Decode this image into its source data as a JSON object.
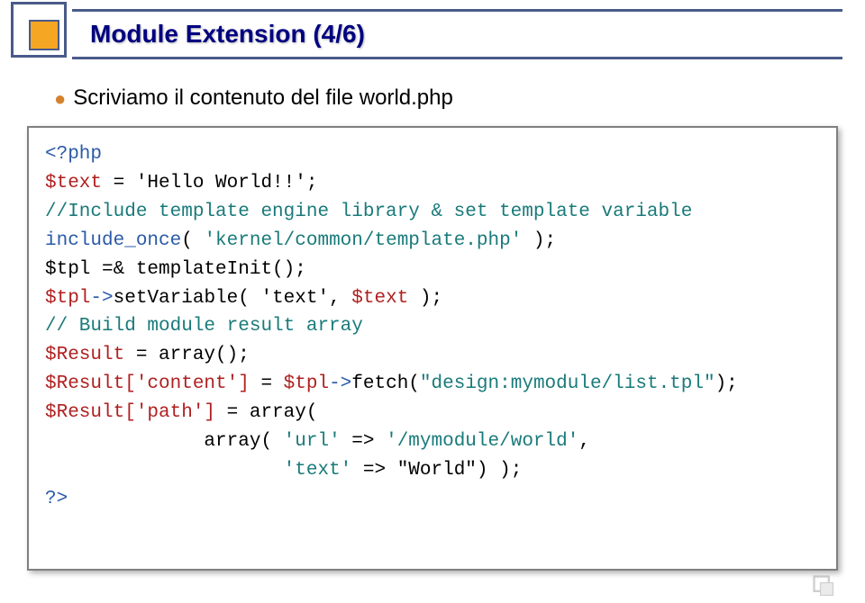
{
  "header": {
    "title": "Module Extension (4/6)"
  },
  "bullet": {
    "text": "Scriviamo il contenuto del file world.php"
  },
  "code": {
    "l1a": "<?php",
    "l2a": "$text",
    "l2b": " = 'Hello World!!';",
    "l3a": "//Include template engine library & set template variable",
    "l4a": "include_once",
    "l4b": "( ",
    "l4c": "'kernel/common/template.php'",
    "l4d": " );",
    "l5a": "$tpl =& templateInit();",
    "l6a": "$tpl",
    "l6b": "->",
    "l6c": "setVariable",
    "l6d": "( 'text', ",
    "l6e": "$text",
    "l6f": " );",
    "l7a": "// Build module result array",
    "l8a": "$Result",
    "l8b": " = array();",
    "l9a": "$Result['content']",
    "l9b": " = ",
    "l9c": "$tpl",
    "l9d": "->",
    "l9e": "fetch(",
    "l9f": "\"design:mymodule/list.tpl\"",
    "l9g": ");",
    "l10a": "$Result['path']",
    "l10b": " = array(",
    "l11a": "              array( ",
    "l11b": "'url'",
    "l11c": " => ",
    "l11d": "'/mymodule/world'",
    "l11e": ",",
    "l12a": "                     ",
    "l12b": "'text'",
    "l12c": " => \"World\") );",
    "l13a": "?>"
  }
}
